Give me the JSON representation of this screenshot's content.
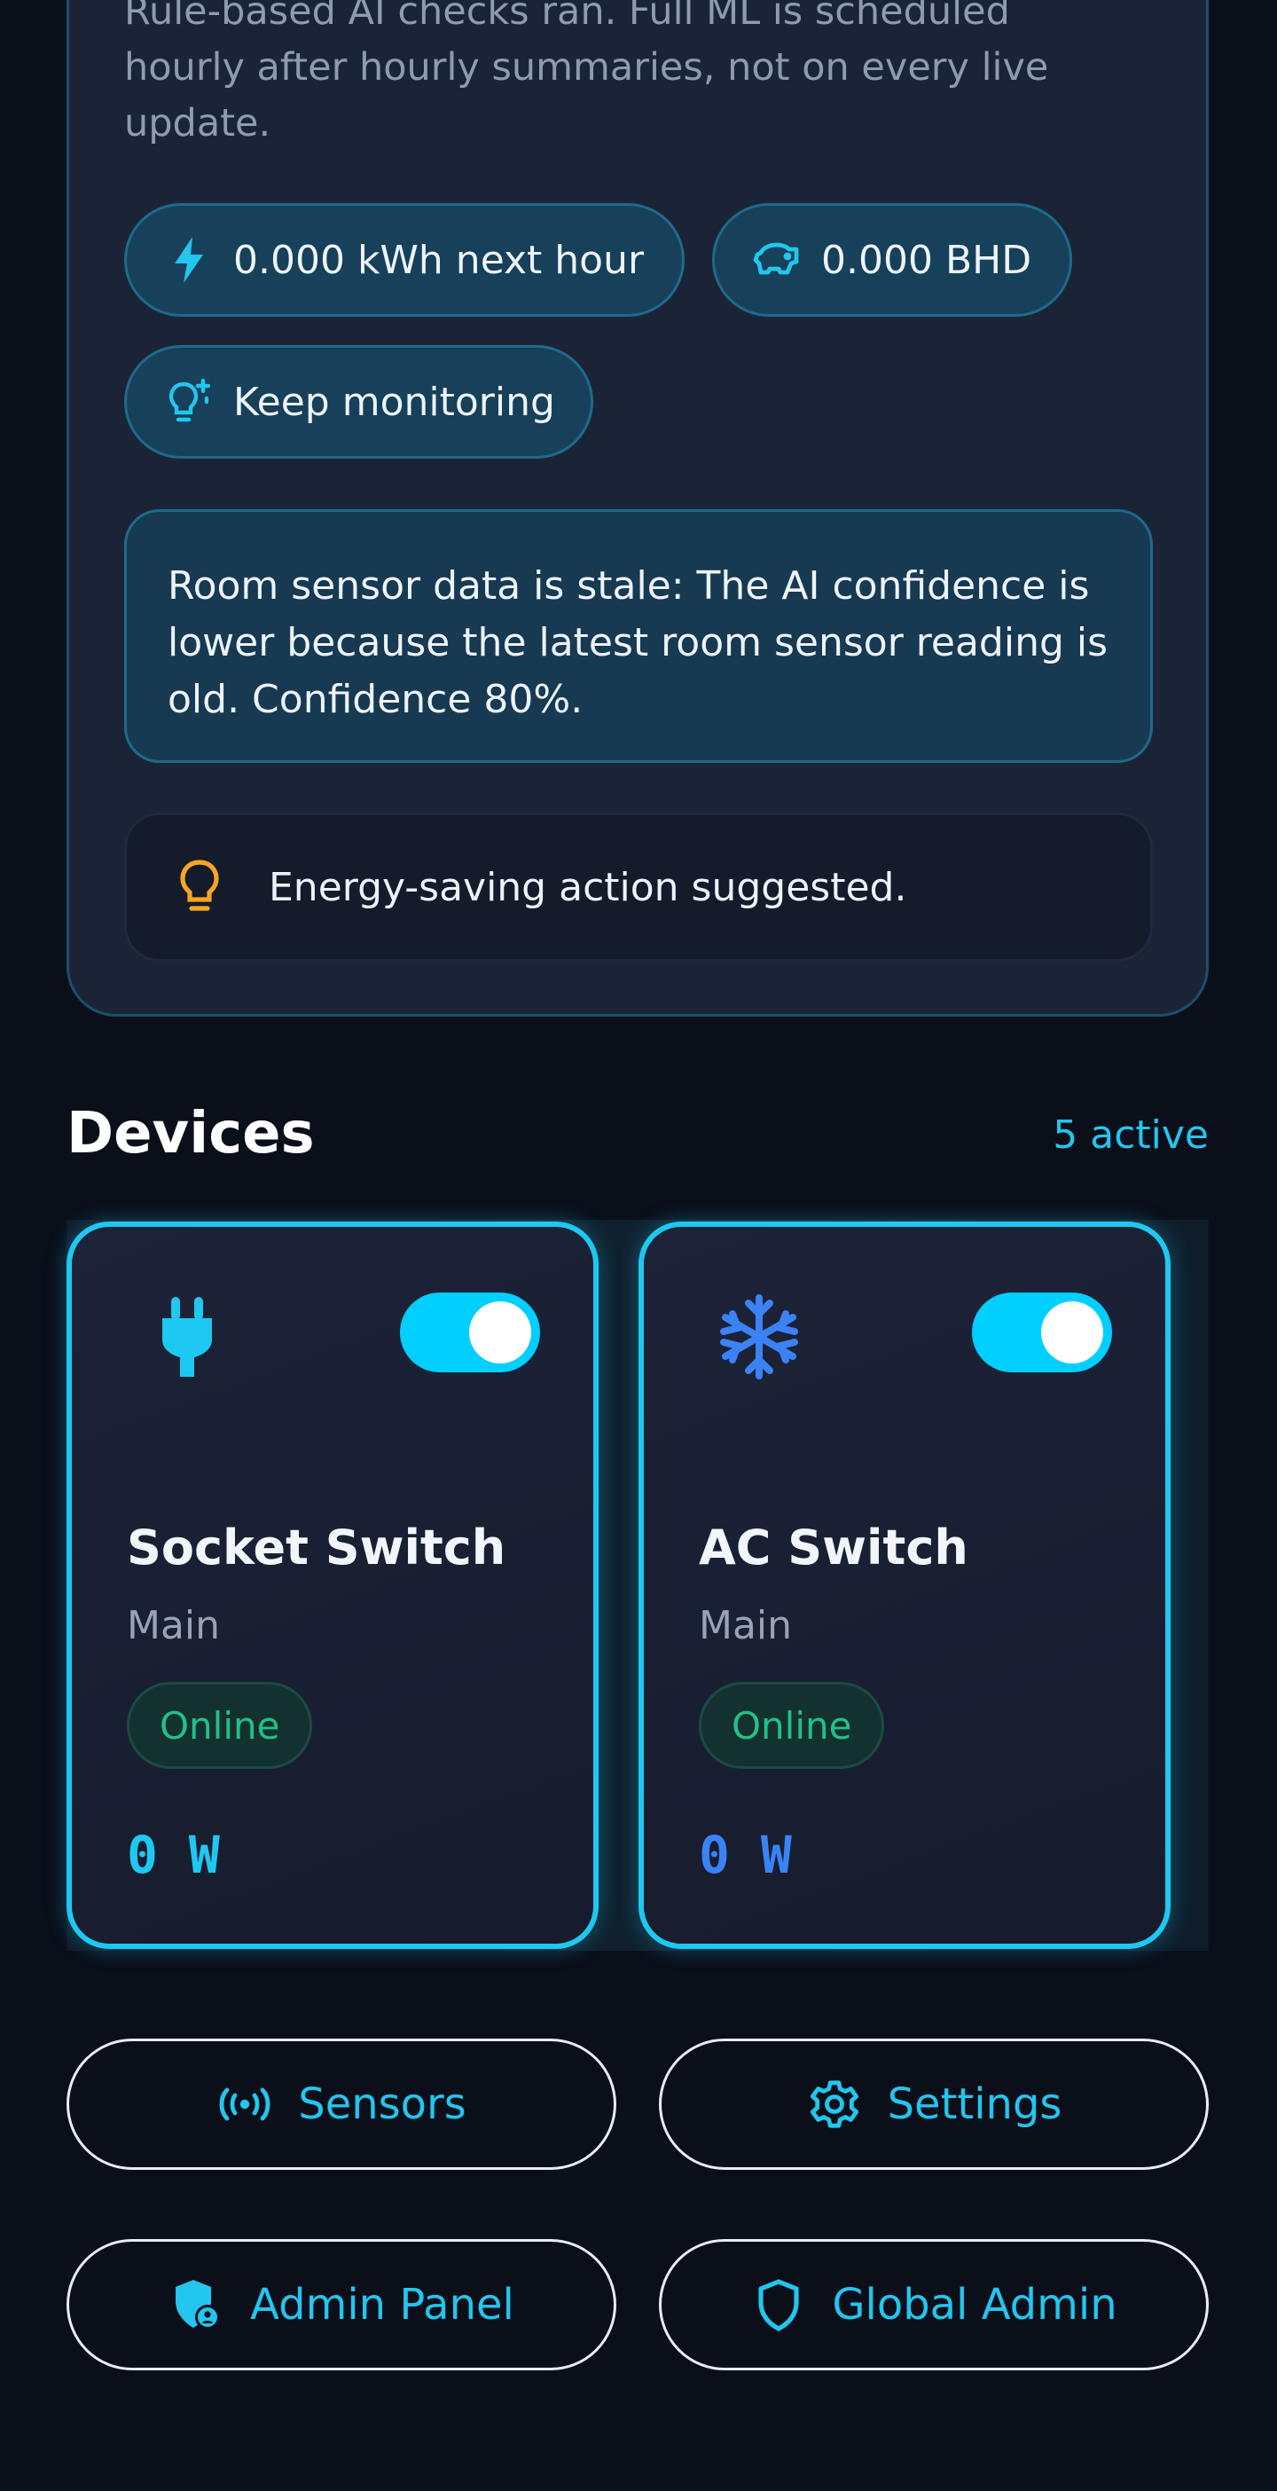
{
  "ai_panel": {
    "description": "Rule-based AI checks ran. Full ML is scheduled hourly after hourly summaries, not on every live update.",
    "chips": {
      "energy": {
        "label": "0.000 kWh next hour",
        "icon": "lightning-icon"
      },
      "cost": {
        "label": "0.000 BHD",
        "icon": "piggy-bank-icon"
      },
      "action": {
        "label": "Keep monitoring",
        "icon": "lightbulb-sparkle-icon"
      }
    },
    "note": "Room sensor data is stale: The AI confidence is lower because the latest room sensor reading is old. Confidence 80%.",
    "suggestion": {
      "text": "Energy-saving action suggested.",
      "icon": "lightbulb-icon"
    }
  },
  "devices": {
    "title": "Devices",
    "active_count": "5 active",
    "items": [
      {
        "name": "Socket Switch",
        "room": "Main",
        "status": "Online",
        "power": "0 W",
        "enabled": true,
        "icon": "plug-icon",
        "icon_color": "#1ec8f0"
      },
      {
        "name": "AC Switch",
        "room": "Main",
        "status": "Online",
        "power": "0 W",
        "enabled": true,
        "icon": "snowflake-icon",
        "icon_color": "#3b82f6"
      }
    ]
  },
  "nav": {
    "sensors": {
      "label": "Sensors",
      "icon": "broadcast-icon"
    },
    "settings": {
      "label": "Settings",
      "icon": "gear-icon"
    },
    "admin_panel": {
      "label": "Admin Panel",
      "icon": "shield-user-icon"
    },
    "global_admin": {
      "label": "Global Admin",
      "icon": "shield-icon"
    }
  },
  "colors": {
    "accent": "#22c6ee",
    "background": "#0a0f1a",
    "online": "#23c086",
    "warning": "#f5a623"
  }
}
